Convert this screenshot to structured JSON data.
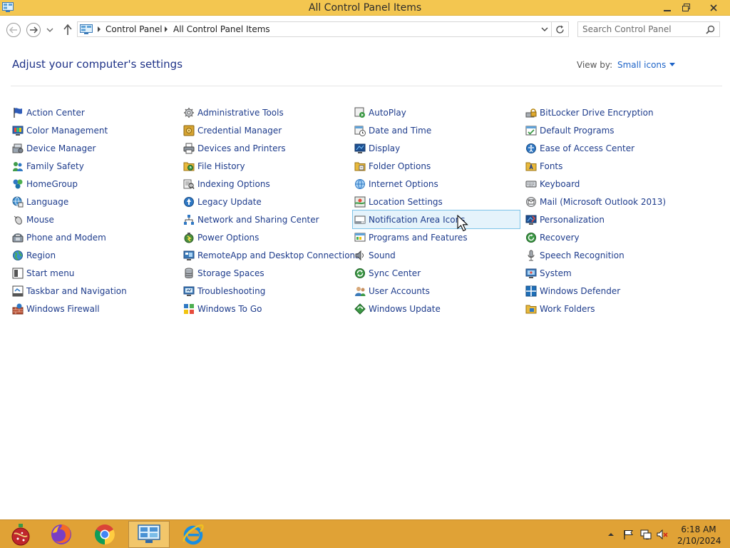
{
  "window": {
    "title": "All Control Panel Items"
  },
  "address": {
    "crumbs": [
      "Control Panel",
      "All Control Panel Items"
    ]
  },
  "search": {
    "placeholder": "Search Control Panel"
  },
  "header": {
    "title": "Adjust your computer's settings",
    "view_by_label": "View by:",
    "view_by_value": "Small icons"
  },
  "items": {
    "col1": [
      "Action Center",
      "Color Management",
      "Device Manager",
      "Family Safety",
      "HomeGroup",
      "Language",
      "Mouse",
      "Phone and Modem",
      "Region",
      "Start menu",
      "Taskbar and Navigation",
      "Windows Firewall"
    ],
    "col2": [
      "Administrative Tools",
      "Credential Manager",
      "Devices and Printers",
      "File History",
      "Indexing Options",
      "Legacy Update",
      "Network and Sharing Center",
      "Power Options",
      "RemoteApp and Desktop Connections",
      "Storage Spaces",
      "Troubleshooting",
      "Windows To Go"
    ],
    "col3": [
      "AutoPlay",
      "Date and Time",
      "Display",
      "Folder Options",
      "Internet Options",
      "Location Settings",
      "Notification Area Icons",
      "Programs and Features",
      "Sound",
      "Sync Center",
      "User Accounts",
      "Windows Update"
    ],
    "col4": [
      "BitLocker Drive Encryption",
      "Default Programs",
      "Ease of Access Center",
      "Fonts",
      "Keyboard",
      "Mail (Microsoft Outlook 2013)",
      "Personalization",
      "Recovery",
      "Speech Recognition",
      "System",
      "Windows Defender",
      "Work Folders"
    ]
  },
  "hovered_item": "Notification Area Icons",
  "taskbar": {
    "apps": [
      "ornament-app-icon",
      "firefox-icon",
      "chrome-icon",
      "control-panel-icon",
      "internet-explorer-icon"
    ],
    "active_app": "control-panel-icon"
  },
  "clock": {
    "time": "6:18 AM",
    "date": "2/10/2024"
  },
  "colors": {
    "titlebar": "#f3c650",
    "taskbar": "#e0a236",
    "link": "#1e3c8c",
    "title": "#1e3287"
  }
}
